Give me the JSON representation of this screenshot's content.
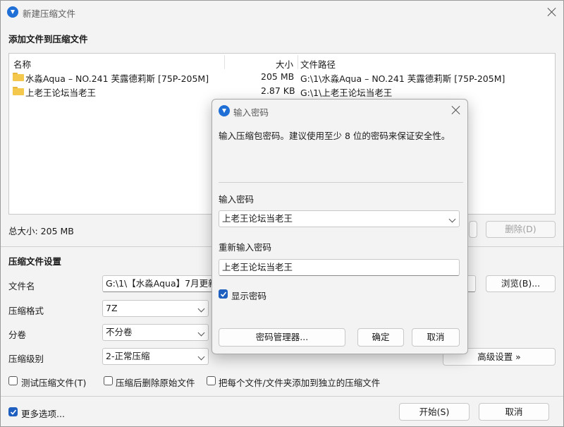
{
  "main": {
    "title": "新建压缩文件",
    "files_header": "添加文件到压缩文件",
    "columns": {
      "name": "名称",
      "size": "大小",
      "path": "文件路径"
    },
    "files": [
      {
        "name": "水淼Aqua – NO.241 芙露德莉斯 [75P-205M]",
        "size": "205 MB",
        "path": "G:\\1\\水淼Aqua – NO.241 芙露德莉斯 [75P-205M]"
      },
      {
        "name": "上老王论坛当老王",
        "size": "2.87 KB",
        "path": "G:\\1\\上老王论坛当老王"
      }
    ],
    "total_size": "总大小: 205 MB",
    "delete_button": "删除(D)",
    "settings_header": "压缩文件设置",
    "filename_label": "文件名",
    "filename_value": "G:\\1\\【水淼Aqua】7月更新",
    "browse_button": "浏览(B)...",
    "format_label": "压缩格式",
    "format_value": "7Z",
    "split_label": "分卷",
    "split_value": "不分卷",
    "level_label": "压缩级别",
    "level_value": "2-正常压缩",
    "advanced_button": "高级设置 »",
    "test_checkbox": "测试压缩文件(T)",
    "delete_after_checkbox": "压缩后删除原始文件",
    "separate_checkbox": "把每个文件/文件夹添加到独立的压缩文件",
    "more_options": "更多选项...",
    "start_button": "开始(S)",
    "cancel_button": "取消",
    "accent": "#1f5fbf"
  },
  "dialog": {
    "title": "输入密码",
    "hint": "输入压缩包密码。建议使用至少 8 位的密码来保证安全性。",
    "password_label": "输入密码",
    "password_value": "上老王论坛当老王",
    "reenter_label": "重新输入密码",
    "reenter_value": "上老王论坛当老王",
    "show_password": "显示密码",
    "manager_button": "密码管理器...",
    "ok_button": "确定",
    "cancel_button": "取消"
  }
}
